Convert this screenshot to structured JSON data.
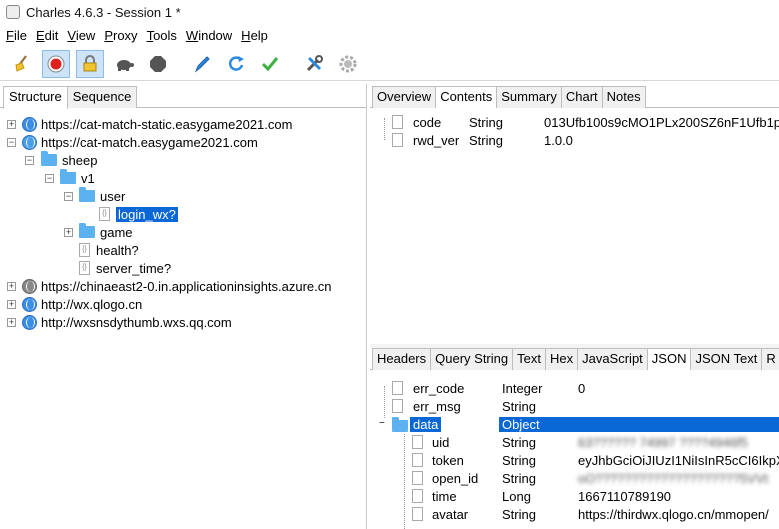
{
  "window": {
    "title": "Charles 4.6.3 - Session 1 *"
  },
  "menu": [
    "File",
    "Edit",
    "View",
    "Proxy",
    "Tools",
    "Window",
    "Help"
  ],
  "menu_mnemonics": [
    "F",
    "E",
    "V",
    "P",
    "T",
    "W",
    "H"
  ],
  "toolbar": {
    "buttons": [
      "broom-icon",
      "record-icon",
      "throttle-icon",
      "turtle-icon",
      "stop-icon",
      "compose-icon",
      "repeat-icon",
      "validate-icon",
      "tools-icon",
      "settings-icon"
    ]
  },
  "left_tabs": [
    "Structure",
    "Sequence"
  ],
  "tree": {
    "hosts": [
      "https://cat-match-static.easygame2021.com",
      "https://cat-match.easygame2021.com",
      "https://chinaeast2-0.in.applicationinsights.azure.cn",
      "http://wx.qlogo.cn",
      "http://wxsnsdythumb.wxs.qq.com"
    ],
    "folder_sheep": "sheep",
    "folder_v1": "v1",
    "folder_user": "user",
    "item_login": "login_wx?",
    "folder_game": "game",
    "item_health": "health?",
    "item_server_time": "server_time?"
  },
  "request_tabs": [
    "Overview",
    "Contents",
    "Summary",
    "Chart",
    "Notes"
  ],
  "request_params": [
    {
      "name": "code",
      "type": "String",
      "value": "013Ufb100s9cMO1PLx200SZ6nF1Ufb1p"
    },
    {
      "name": "rwd_ver",
      "type": "String",
      "value": "1.0.0"
    }
  ],
  "response_tabs": [
    "Headers",
    "Query String",
    "Text",
    "Hex",
    "JavaScript",
    "JSON",
    "JSON Text",
    "R"
  ],
  "response_json": [
    {
      "name": "err_code",
      "type": "Integer",
      "value": "0"
    },
    {
      "name": "err_msg",
      "type": "String",
      "value": ""
    },
    {
      "name": "data",
      "type": "Object",
      "value": ""
    },
    {
      "name": "uid",
      "type": "String",
      "value": "63?????? 74997 ????4946f5"
    },
    {
      "name": "token",
      "type": "String",
      "value": "eyJhbGciOiJIUzI1NiIsInR5cCI6IkpX"
    },
    {
      "name": "open_id",
      "type": "String",
      "value": "oO????????????????????5VVt"
    },
    {
      "name": "time",
      "type": "Long",
      "value": "1667110789190"
    },
    {
      "name": "avatar",
      "type": "String",
      "value": "https://thirdwx.qlogo.cn/mmopen/"
    }
  ],
  "colors": {
    "selection": "#0a67d6",
    "folder": "#5cb2f0",
    "record": "#e02020"
  }
}
